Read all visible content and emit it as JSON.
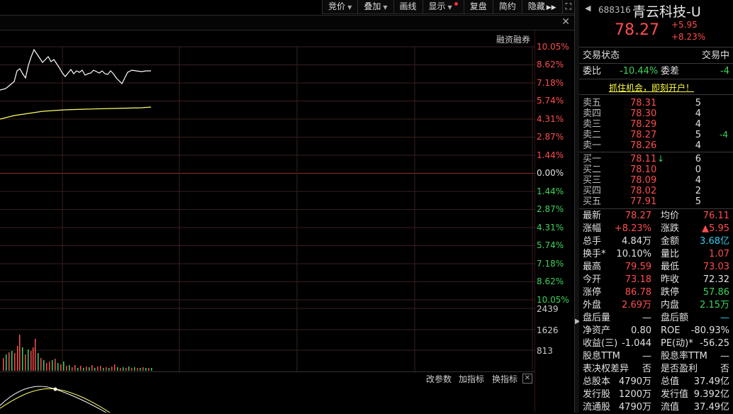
{
  "toolbar": {
    "buttons": [
      "竞价",
      "叠加",
      "画线",
      "显示",
      "复盘",
      "简约",
      "隐藏"
    ],
    "expand_icon": "fullscreen-icon",
    "next_icon": "double-right-arrow-icon"
  },
  "chart_title": "融资融券",
  "close_icon": "close-icon",
  "price_axis": {
    "upper": [
      "10.05%",
      "8.62%",
      "7.18%",
      "5.74%",
      "4.31%",
      "2.87%",
      "1.44%"
    ],
    "zero": "0.00%",
    "lower": [
      "1.44%",
      "2.87%",
      "4.31%",
      "5.74%",
      "7.18%",
      "8.62%",
      "10.05%"
    ]
  },
  "volume_axis": [
    "2439",
    "1626",
    "813"
  ],
  "sub_buttons": [
    "改参数",
    "加指标",
    "换指标"
  ],
  "colors": {
    "up": "#ff4d4d",
    "down": "#3cd45a",
    "price_line": "#ffffff",
    "avg_line": "#ffff66",
    "grid": "#3a1f1f"
  },
  "stock": {
    "code": "688316",
    "name": "青云科技-U",
    "price": "78.27",
    "change": "+5.95",
    "change_pct": "+8.23%"
  },
  "status": {
    "label": "交易状态",
    "value": "交易中"
  },
  "weibi": {
    "label": "委比",
    "value": "-10.44%",
    "diff_label": "委差",
    "diff_value": "-4"
  },
  "promo": "抓住机会，即刻开户！",
  "asks": [
    {
      "label": "卖五",
      "price": "78.31",
      "vol": "5",
      "extra": ""
    },
    {
      "label": "卖四",
      "price": "78.30",
      "vol": "4",
      "extra": ""
    },
    {
      "label": "卖三",
      "price": "78.29",
      "vol": "4",
      "extra": ""
    },
    {
      "label": "卖二",
      "price": "78.27",
      "vol": "5",
      "extra": "-4"
    },
    {
      "label": "卖一",
      "price": "78.26",
      "vol": "4",
      "extra": ""
    }
  ],
  "bids": [
    {
      "label": "买一",
      "price": "78.11",
      "vol": "6",
      "marker": "↓"
    },
    {
      "label": "买二",
      "price": "78.10",
      "vol": "0",
      "marker": ""
    },
    {
      "label": "买三",
      "price": "78.09",
      "vol": "4",
      "marker": ""
    },
    {
      "label": "买四",
      "price": "78.02",
      "vol": "2",
      "marker": ""
    },
    {
      "label": "买五",
      "price": "77.91",
      "vol": "5",
      "marker": ""
    }
  ],
  "stats": [
    {
      "l1": "最新",
      "v1": "78.27",
      "c1": "red",
      "l2": "均价",
      "v2": "76.11",
      "c2": "red"
    },
    {
      "l1": "涨幅",
      "v1": "+8.23%",
      "c1": "red",
      "l2": "涨跌",
      "v2": "▲5.95",
      "c2": "red"
    },
    {
      "l1": "总手",
      "v1": "4.84万",
      "c1": "white",
      "l2": "金额",
      "v2": "3.68亿",
      "c2": "cyan"
    },
    {
      "l1": "换手*",
      "v1": "10.10%",
      "c1": "white",
      "l2": "量比",
      "v2": "1.07",
      "c2": "red"
    },
    {
      "l1": "最高",
      "v1": "79.59",
      "c1": "red",
      "l2": "最低",
      "v2": "73.03",
      "c2": "red"
    },
    {
      "l1": "今开",
      "v1": "73.18",
      "c1": "red",
      "l2": "昨收",
      "v2": "72.32",
      "c2": "white"
    },
    {
      "l1": "涨停",
      "v1": "86.78",
      "c1": "red",
      "l2": "跌停",
      "v2": "57.86",
      "c2": "green"
    },
    {
      "l1": "外盘",
      "v1": "2.69万",
      "c1": "red",
      "l2": "内盘",
      "v2": "2.15万",
      "c2": "green"
    },
    {
      "l1": "盘后量",
      "v1": "—",
      "c1": "white",
      "l2": "盘后额",
      "v2": "—",
      "c2": "cyan"
    },
    {
      "l1": "净资产",
      "v1": "0.80",
      "c1": "white",
      "l2": "ROE",
      "v2": "-80.93%",
      "c2": "white"
    },
    {
      "l1": "收益(三)",
      "v1": "-1.044",
      "c1": "white",
      "l2": "PE(动)*",
      "v2": "-56.25",
      "c2": "white"
    },
    {
      "l1": "股息TTM",
      "v1": "—",
      "c1": "white",
      "l2": "股息率TTM",
      "v2": "—",
      "c2": "white"
    },
    {
      "l1": "表决权差异",
      "v1": "否",
      "c1": "white",
      "l2": "是否盈利",
      "v2": "否",
      "c2": "white"
    },
    {
      "l1": "总股本",
      "v1": "4790万",
      "c1": "white",
      "l2": "总值",
      "v2": "37.49亿",
      "c2": "white"
    },
    {
      "l1": "发行股",
      "v1": "1200万",
      "c1": "white",
      "l2": "发行值",
      "v2": "9.392亿",
      "c2": "white"
    },
    {
      "l1": "流通股",
      "v1": "4790万",
      "c1": "white",
      "l2": "流值",
      "v2": "37.49亿",
      "c2": "white"
    }
  ]
}
